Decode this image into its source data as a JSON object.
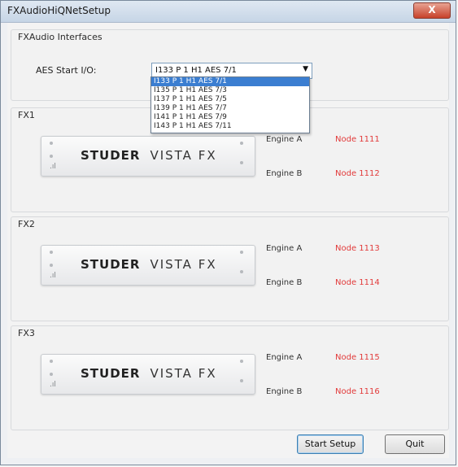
{
  "window": {
    "title": "FXAudioHiQNetSetup",
    "close_label": "X"
  },
  "interfaces": {
    "group_label": "FXAudio Interfaces",
    "aes_label": "AES Start I/O:",
    "selected": "I133 P 1 H1 AES 7/1",
    "options": [
      "I133 P 1 H1 AES 7/1",
      "I135 P 1 H1 AES 7/3",
      "I137 P 1 H1 AES 7/5",
      "I139 P 1 H1 AES 7/7",
      "I141 P 1 H1 AES 7/9",
      "I143 P 1 H1 AES 7/11"
    ]
  },
  "fx_groups": [
    {
      "label": "FX1",
      "engine_a": "Engine A",
      "node_a": "Node 1111",
      "engine_b": "Engine B",
      "node_b": "Node 1112"
    },
    {
      "label": "FX2",
      "engine_a": "Engine A",
      "node_a": "Node 1113",
      "engine_b": "Engine B",
      "node_b": "Node 1114"
    },
    {
      "label": "FX3",
      "engine_a": "Engine A",
      "node_a": "Node 1115",
      "engine_b": "Engine B",
      "node_b": "Node 1116"
    }
  ],
  "device": {
    "brand": "STUDER",
    "model": "VISTA FX"
  },
  "buttons": {
    "start_setup": "Start Setup",
    "quit": "Quit"
  }
}
